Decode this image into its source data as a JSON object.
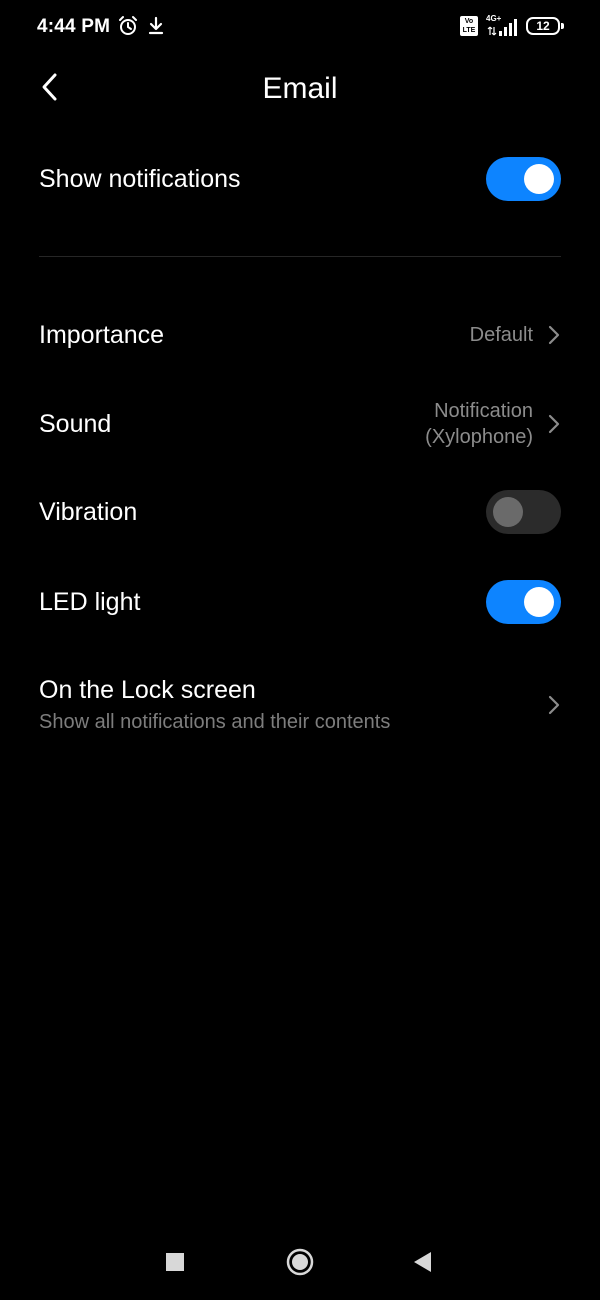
{
  "status_bar": {
    "time": "4:44 PM",
    "icons": [
      "alarm-icon",
      "download-icon",
      "volte-icon",
      "signal-icon",
      "battery-icon"
    ],
    "volte_top": "Vo",
    "volte_bottom": "LTE",
    "network": "4G+",
    "battery_level": "12"
  },
  "header": {
    "title": "Email",
    "back_icon": "chevron-left-icon"
  },
  "settings": {
    "show_notifications": {
      "label": "Show notifications",
      "enabled": true
    },
    "importance": {
      "label": "Importance",
      "value": "Default"
    },
    "sound": {
      "label": "Sound",
      "value_line1": "Notification",
      "value_line2": "(Xylophone)"
    },
    "vibration": {
      "label": "Vibration",
      "enabled": false
    },
    "led_light": {
      "label": "LED light",
      "enabled": true
    },
    "lock_screen": {
      "label": "On the Lock screen",
      "subtitle": "Show all notifications and their contents"
    }
  },
  "nav_bar": {
    "icons": [
      "recents-square-icon",
      "home-circle-icon",
      "back-triangle-icon"
    ]
  },
  "colors": {
    "background": "#000000",
    "accent": "#0d84ff",
    "secondary_text": "#8c8c8c",
    "toggle_off": "#2b2b2b"
  }
}
